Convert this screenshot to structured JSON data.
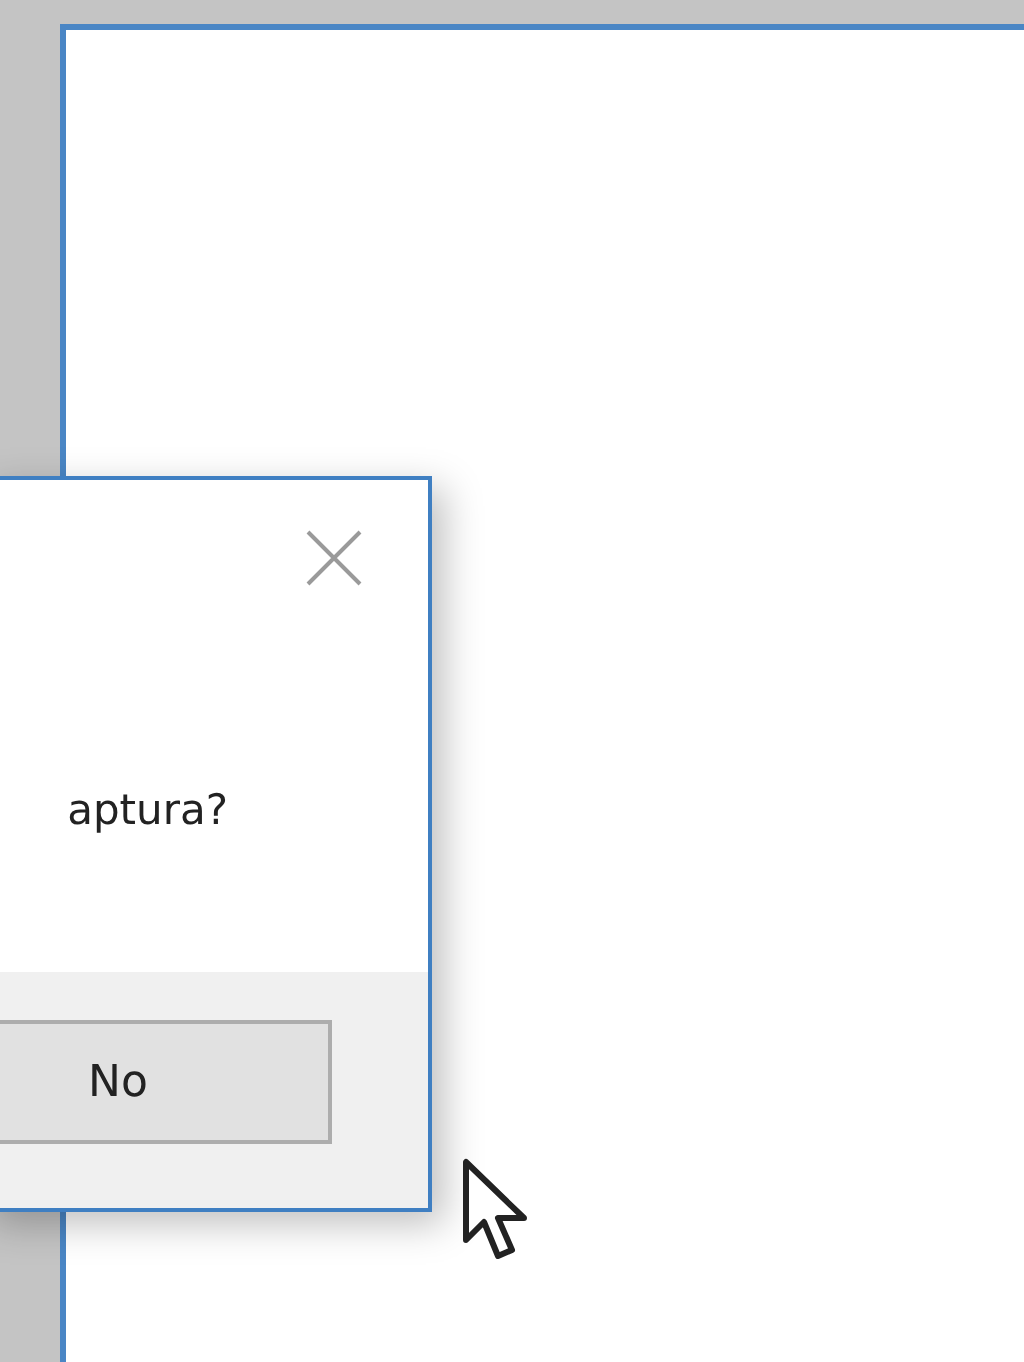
{
  "dialog": {
    "message": "aptura?",
    "buttons": [
      {
        "label": "No"
      }
    ]
  }
}
